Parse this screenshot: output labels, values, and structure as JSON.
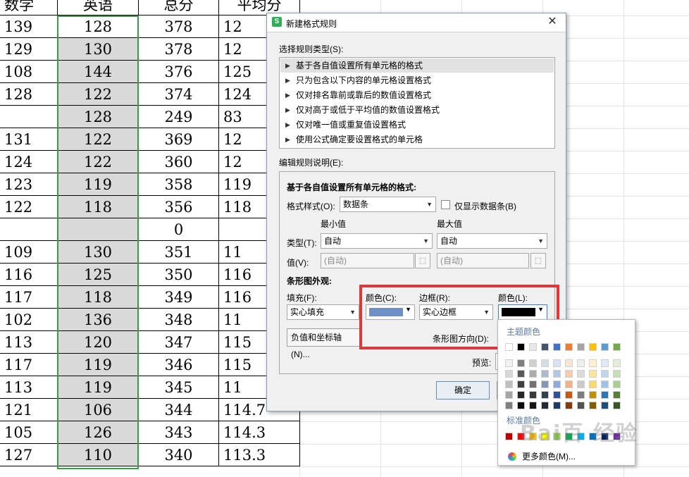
{
  "sheet": {
    "headers": [
      "数学",
      "英语",
      "总分",
      "平均分"
    ],
    "rows": [
      [
        "139",
        "128",
        "378",
        "12"
      ],
      [
        "129",
        "130",
        "378",
        "12"
      ],
      [
        "108",
        "144",
        "376",
        "125"
      ],
      [
        "128",
        "122",
        "374",
        "124"
      ],
      [
        "",
        "128",
        "249",
        "83"
      ],
      [
        "131",
        "122",
        "369",
        "12"
      ],
      [
        "124",
        "122",
        "360",
        "12"
      ],
      [
        "123",
        "119",
        "358",
        "119"
      ],
      [
        "122",
        "118",
        "356",
        "118"
      ],
      [
        "",
        "",
        "0",
        ""
      ],
      [
        "109",
        "130",
        "351",
        "11"
      ],
      [
        "116",
        "125",
        "350",
        "116"
      ],
      [
        "117",
        "118",
        "349",
        "116"
      ],
      [
        "102",
        "136",
        "348",
        "11"
      ],
      [
        "113",
        "120",
        "347",
        "115"
      ],
      [
        "117",
        "119",
        "346",
        "115"
      ],
      [
        "113",
        "119",
        "345",
        "11"
      ],
      [
        "121",
        "106",
        "344",
        "114.7"
      ],
      [
        "105",
        "126",
        "343",
        "114.3"
      ],
      [
        "127",
        "110",
        "340",
        "113.3"
      ]
    ]
  },
  "dialog": {
    "title": "新建格式规则",
    "close_glyph": "✕",
    "app_icon_glyph": "S",
    "select_type_label": "选择规则类型(S):",
    "rule_types": [
      "基于各自值设置所有单元格的格式",
      "只为包含以下内容的单元格设置格式",
      "仅对排名靠前或靠后的数值设置格式",
      "仅对高于或低于平均值的数值设置格式",
      "仅对唯一值或重复值设置格式",
      "使用公式确定要设置格式的单元格"
    ],
    "edit_desc_label": "编辑规则说明(E):",
    "desc_heading": "基于各自值设置所有单元格的格式:",
    "format_style_label": "格式样式(O):",
    "format_style_value": "数据条",
    "show_bar_only_label": "仅显示数据条(B)",
    "min_label": "最小值",
    "max_label": "最大值",
    "type_label": "类型(T):",
    "type_min_value": "自动",
    "type_max_value": "自动",
    "value_label": "值(V):",
    "value_min_placeholder": "(自动)",
    "value_max_placeholder": "(自动)",
    "bar_appearance_label": "条形图外观:",
    "fill_label": "填充(F):",
    "fill_value": "实心填充",
    "color_label": "颜色(C):",
    "border_label": "边框(R):",
    "border_value": "实心边框",
    "border_color_label": "颜色(L):",
    "negative_axis_button": "负值和坐标轴(N)...",
    "bar_direction_label": "条形图方向(D):",
    "preview_label": "预览:",
    "ok_button": "确定",
    "arrow_glyph": "▶",
    "dropdown_glyph": "▼",
    "picker_glyph": "⬚"
  },
  "colors": {
    "fill_color": "#6f8fcb",
    "border_color": "#000000",
    "highlight": "#e0373b",
    "selection_border": "#3a9a47",
    "gray_fill": "#d9d9d9"
  },
  "palette": {
    "theme_heading": "主题颜色",
    "standard_heading": "标准颜色",
    "more_colors_label": "更多颜色(M)...",
    "theme_top": [
      "#ffffff",
      "#000000",
      "#e7e6e6",
      "#44546a",
      "#4472c4",
      "#ed7d31",
      "#a5a5a5",
      "#ffc000",
      "#5b9bd5",
      "#70ad47"
    ],
    "theme_shades": [
      [
        "#f2f2f2",
        "#7f7f7f",
        "#d0cece",
        "#d6dce4",
        "#d9e2f3",
        "#fbe5d5",
        "#ededed",
        "#fff2cc",
        "#deebf6",
        "#e2efd9"
      ],
      [
        "#d8d8d8",
        "#595959",
        "#aeabab",
        "#adb9ca",
        "#b4c6e7",
        "#f7cbac",
        "#dbdbdb",
        "#fee599",
        "#bdd7ee",
        "#c5e0b3"
      ],
      [
        "#bfbfbf",
        "#3f3f3f",
        "#757070",
        "#8496b0",
        "#8eaadb",
        "#f4b183",
        "#c9c9c9",
        "#ffd965",
        "#9dc3e6",
        "#a8d08d"
      ],
      [
        "#a5a5a5",
        "#262626",
        "#3a3838",
        "#323f4f",
        "#2f5496",
        "#c55a11",
        "#7b7b7b",
        "#bf9000",
        "#2e75b5",
        "#538135"
      ],
      [
        "#7f7f7f",
        "#0c0c0c",
        "#171616",
        "#222a35",
        "#1f3864",
        "#833c0b",
        "#525252",
        "#7f6000",
        "#1e4e79",
        "#375623"
      ]
    ],
    "standard": [
      "#c00000",
      "#ff0000",
      "#ffc000",
      "#ffff00",
      "#92d050",
      "#00b050",
      "#00b0f0",
      "#0070c0",
      "#002060",
      "#7030a0"
    ]
  },
  "watermark": "Bai百 经验"
}
